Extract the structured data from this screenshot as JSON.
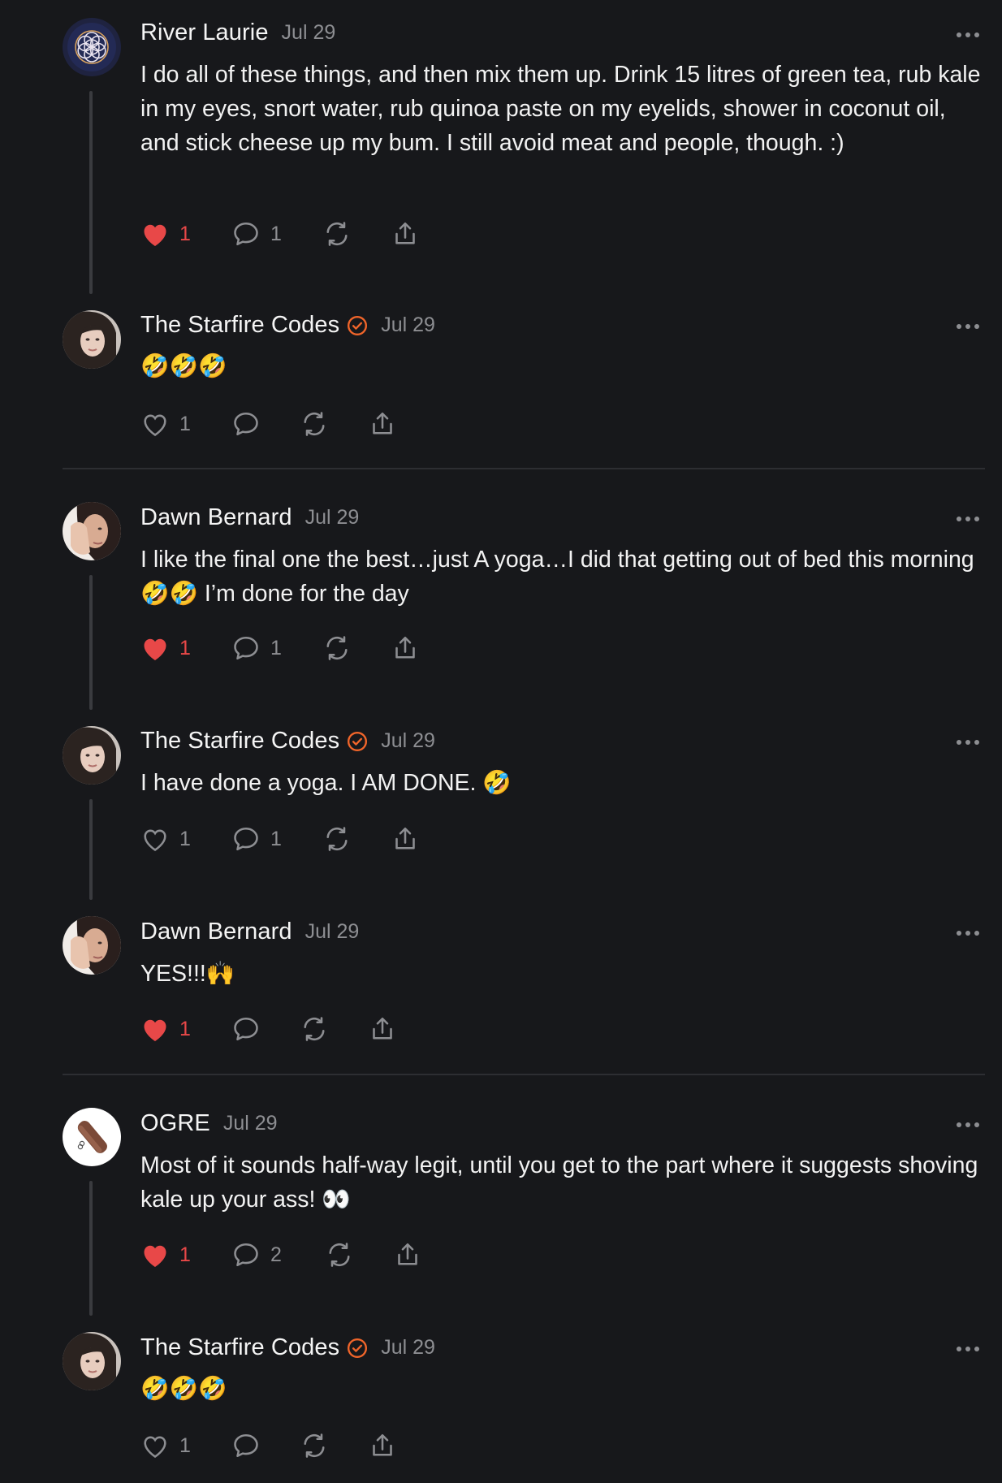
{
  "comments": [
    {
      "name": "River Laurie",
      "date": "Jul 29",
      "verified": false,
      "text": "I do all of these things, and then mix them up. Drink 15 litres of green tea, rub kale in my eyes, snort water, rub quinoa paste on my eyelids, shower in coconut oil, and stick cheese up my bum. I still avoid meat and people, though. :)",
      "likes": "1",
      "liked": true,
      "replies": "1",
      "avatar": "flower-of-life"
    },
    {
      "name": "The Starfire Codes",
      "date": "Jul 29",
      "verified": true,
      "text": "🤣🤣🤣",
      "likes": "1",
      "liked": false,
      "replies": "",
      "avatar": "woman-portrait"
    },
    {
      "name": "Dawn Bernard",
      "date": "Jul 29",
      "verified": false,
      "text": "I like the final one the best…just A yoga…I did that getting out of bed this morning 🤣🤣 I’m done for the day",
      "likes": "1",
      "liked": true,
      "replies": "1",
      "avatar": "woman-hand-portrait"
    },
    {
      "name": "The Starfire Codes",
      "date": "Jul 29",
      "verified": true,
      "text": "I have done a yoga. I AM DONE. 🤣",
      "likes": "1",
      "liked": false,
      "replies": "1",
      "avatar": "woman-portrait"
    },
    {
      "name": "Dawn Bernard",
      "date": "Jul 29",
      "verified": false,
      "text": "YES!!!🙌",
      "likes": "1",
      "liked": true,
      "replies": "",
      "avatar": "woman-hand-portrait"
    },
    {
      "name": "OGRE",
      "date": "Jul 29",
      "verified": false,
      "text": "Most of it sounds half-way legit, until you get to the part where it suggests shoving kale up your ass! 👀",
      "likes": "1",
      "liked": true,
      "replies": "2",
      "avatar": "leather-pouch"
    },
    {
      "name": "The Starfire Codes",
      "date": "Jul 29",
      "verified": true,
      "text": "🤣🤣🤣",
      "likes": "1",
      "liked": false,
      "replies": "",
      "avatar": "woman-portrait"
    }
  ],
  "colors": {
    "background": "#17181b",
    "liked": "#e84848",
    "muted": "#8d8e92",
    "verified": "#f0652a"
  }
}
